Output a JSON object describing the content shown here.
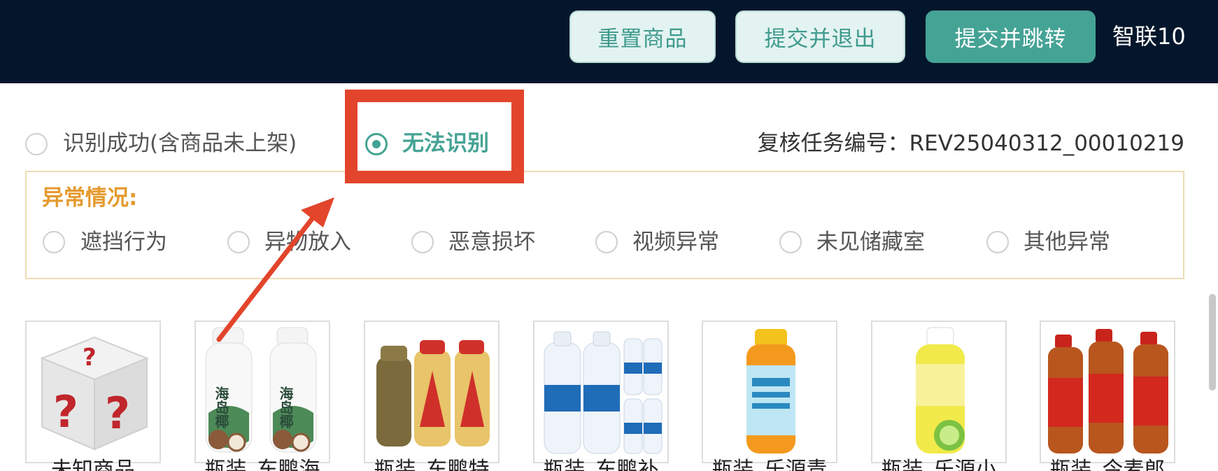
{
  "header": {
    "reset_label": "重置商品",
    "submit_exit_label": "提交并退出",
    "submit_jump_label": "提交并跳转",
    "user_name": "智联10"
  },
  "status": {
    "options": [
      {
        "label": "识别成功(含商品未上架)",
        "checked": false
      },
      {
        "label": "无法识别",
        "checked": true
      }
    ],
    "task_number_label": "复核任务编号：",
    "task_number": "REV25040312_00010219"
  },
  "exceptions": {
    "title": "异常情况:",
    "options": [
      {
        "label": "遮挡行为",
        "checked": false
      },
      {
        "label": "异物放入",
        "checked": false
      },
      {
        "label": "恶意损坏",
        "checked": false
      },
      {
        "label": "视频异常",
        "checked": false
      },
      {
        "label": "未见储藏室",
        "checked": false
      },
      {
        "label": "其他异常",
        "checked": false
      }
    ]
  },
  "products": [
    {
      "name": "未知商品",
      "icon": "question-cube-icon"
    },
    {
      "name": "瓶装_东鹏海",
      "icon": "coconut-bottle-icon"
    },
    {
      "name": "瓶装_东鹏特",
      "icon": "energy-drink-bottle-icon"
    },
    {
      "name": "瓶装_东鹏补",
      "icon": "water-bottle-icon"
    },
    {
      "name": "瓶装_乐源青",
      "icon": "orange-juice-bottle-icon"
    },
    {
      "name": "瓶装_乐源小",
      "icon": "lime-juice-bottle-icon"
    },
    {
      "name": "瓶装_今麦郎",
      "icon": "iced-tea-bottle-icon"
    }
  ],
  "colors": {
    "header_bg": "#04162b",
    "accent": "#45a395",
    "warning": "#e59a2e",
    "highlight": "#e2452b"
  }
}
